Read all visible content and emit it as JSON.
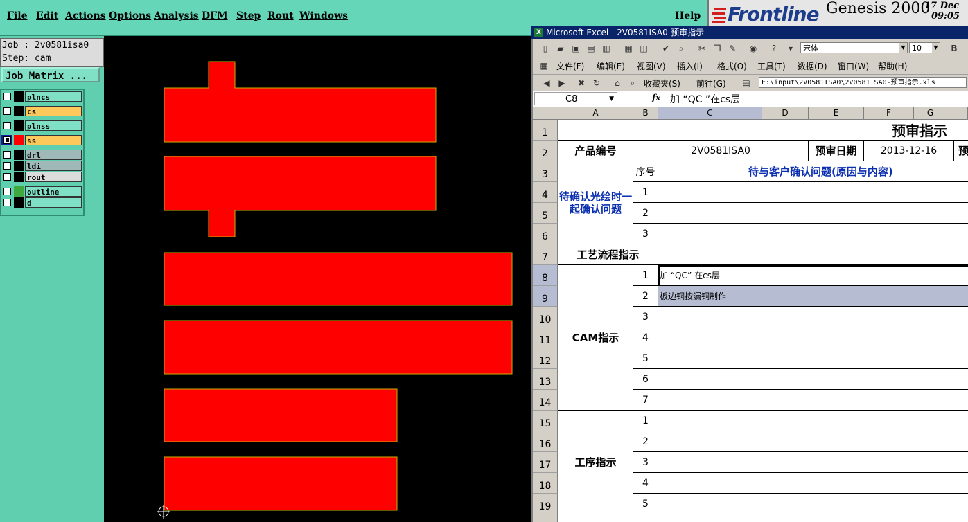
{
  "genesis": {
    "menu": [
      "File",
      "Edit",
      "Actions",
      "Options",
      "Analysis",
      "DFM",
      "Step",
      "Rout",
      "Windows"
    ],
    "help": "Help",
    "brand": "Frontline",
    "product": "Genesis 2000",
    "date": "17 Dec",
    "time": "09:05",
    "job_line": "Job : 2v0581isa0",
    "step_line": "Step: cam",
    "job_matrix": "Job Matrix ...",
    "layers": [
      {
        "name": "plncs",
        "bg": "#7fe0c6",
        "swatch": "#000000",
        "checked": false
      },
      {
        "name": "cs",
        "bg": "#ffc85a",
        "swatch": "#000000",
        "checked": false
      },
      {
        "name": "plnss",
        "bg": "#7fe0c6",
        "swatch": "#000000",
        "checked": false
      },
      {
        "name": "ss",
        "bg": "#ffc85a",
        "swatch": "#ff0000",
        "checked": true
      },
      {
        "name": "drl",
        "bg": "#9fb8b8",
        "swatch": "#000000",
        "checked": false
      },
      {
        "name": "ldi",
        "bg": "#9fb8b8",
        "swatch": "#000000",
        "checked": false
      },
      {
        "name": "rout",
        "bg": "#dcdcdc",
        "swatch": "#000000",
        "checked": false
      },
      {
        "name": "outline",
        "bg": "#7fe0c6",
        "swatch": "#3fa83f",
        "checked": false
      },
      {
        "name": "d",
        "bg": "#7fe0c6",
        "swatch": "#000000",
        "checked": false
      }
    ]
  },
  "excel": {
    "title": "Microsoft Excel - 2V0581ISA0-预审指示",
    "font_name": "宋体",
    "font_size": "10",
    "menus": [
      "文件(F)",
      "编辑(E)",
      "视图(V)",
      "插入(I)",
      "格式(O)",
      "工具(T)",
      "数据(D)",
      "窗口(W)",
      "帮助(H)"
    ],
    "web": {
      "favorites": "收藏夹(S)",
      "goto": "前往(G)",
      "path": "E:\\input\\2V0581ISA0\\2V0581ISA0-预审指示.xls"
    },
    "cell_ref": "C8",
    "fx": "fx",
    "formula": "加 “QC ”在cs层",
    "columns": [
      "A",
      "B",
      "C",
      "D",
      "E",
      "F",
      "G"
    ],
    "rows": [
      "1",
      "2",
      "3",
      "4",
      "5",
      "6",
      "7",
      "8",
      "9",
      "10",
      "11",
      "12",
      "13",
      "14",
      "15",
      "16",
      "17",
      "18",
      "19"
    ],
    "cells": {
      "title": "预审指示",
      "product_label": "产品编号",
      "product_no": "2V0581ISA0",
      "review_date_label": "预审日期",
      "review_date": "2013-12-16",
      "trailing": "预",
      "seq_header": "序号",
      "issues_header": "待与客户确认问题(原因与内容)",
      "confirm_label": "待确认光绘时一起确认问题",
      "process_label": "工艺流程指示",
      "cam_label": "CAM指示",
      "op_label": "工序指示",
      "cam_item1": "加 “QC” 在cs层",
      "cam_item2": "板边铜按漏铜制作",
      "seq_confirm": [
        "1",
        "2",
        "3"
      ],
      "seq_cam": [
        "1",
        "2",
        "3",
        "4",
        "5",
        "6",
        "7"
      ],
      "seq_op": [
        "1",
        "2",
        "3",
        "4",
        "5"
      ]
    }
  }
}
